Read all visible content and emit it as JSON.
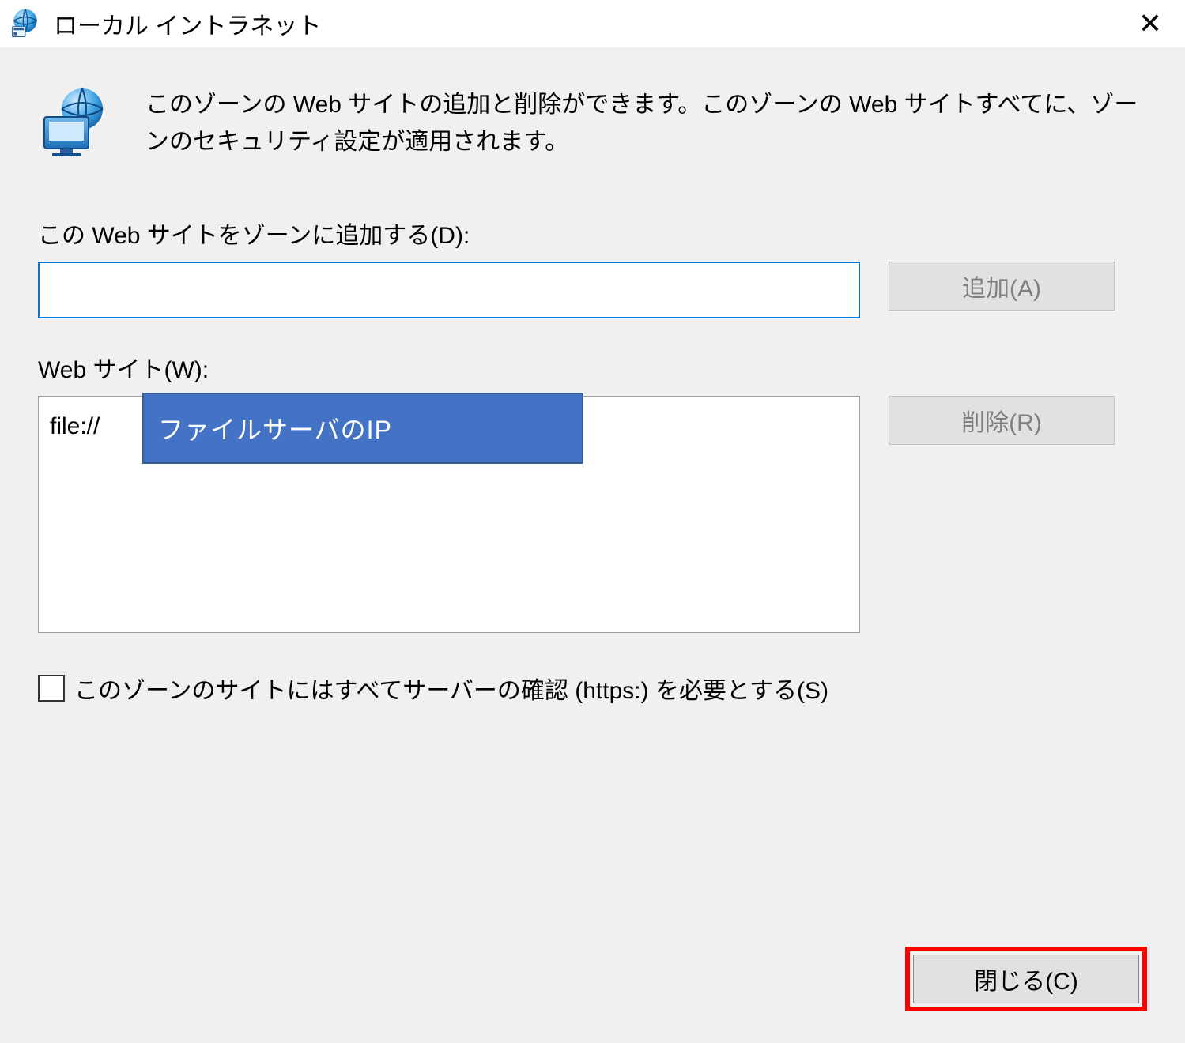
{
  "titlebar": {
    "title": "ローカル イントラネット",
    "close_glyph": "✕"
  },
  "hero": {
    "description": "このゾーンの Web サイトの追加と削除ができます。このゾーンの Web サイトすべてに、ゾーンのセキュリティ設定が適用されます。"
  },
  "add_section": {
    "label": "この Web サイトをゾーンに追加する(D):",
    "value": "",
    "button": "追加(A)"
  },
  "list_section": {
    "label": "Web サイト(W):",
    "items": [
      "file://"
    ],
    "button": "削除(R)",
    "callout": "ファイルサーバのIP"
  },
  "https_check": {
    "checked": false,
    "label": "このゾーンのサイトにはすべてサーバーの確認 (https:) を必要とする(S)"
  },
  "footer": {
    "close": "閉じる(C)"
  }
}
